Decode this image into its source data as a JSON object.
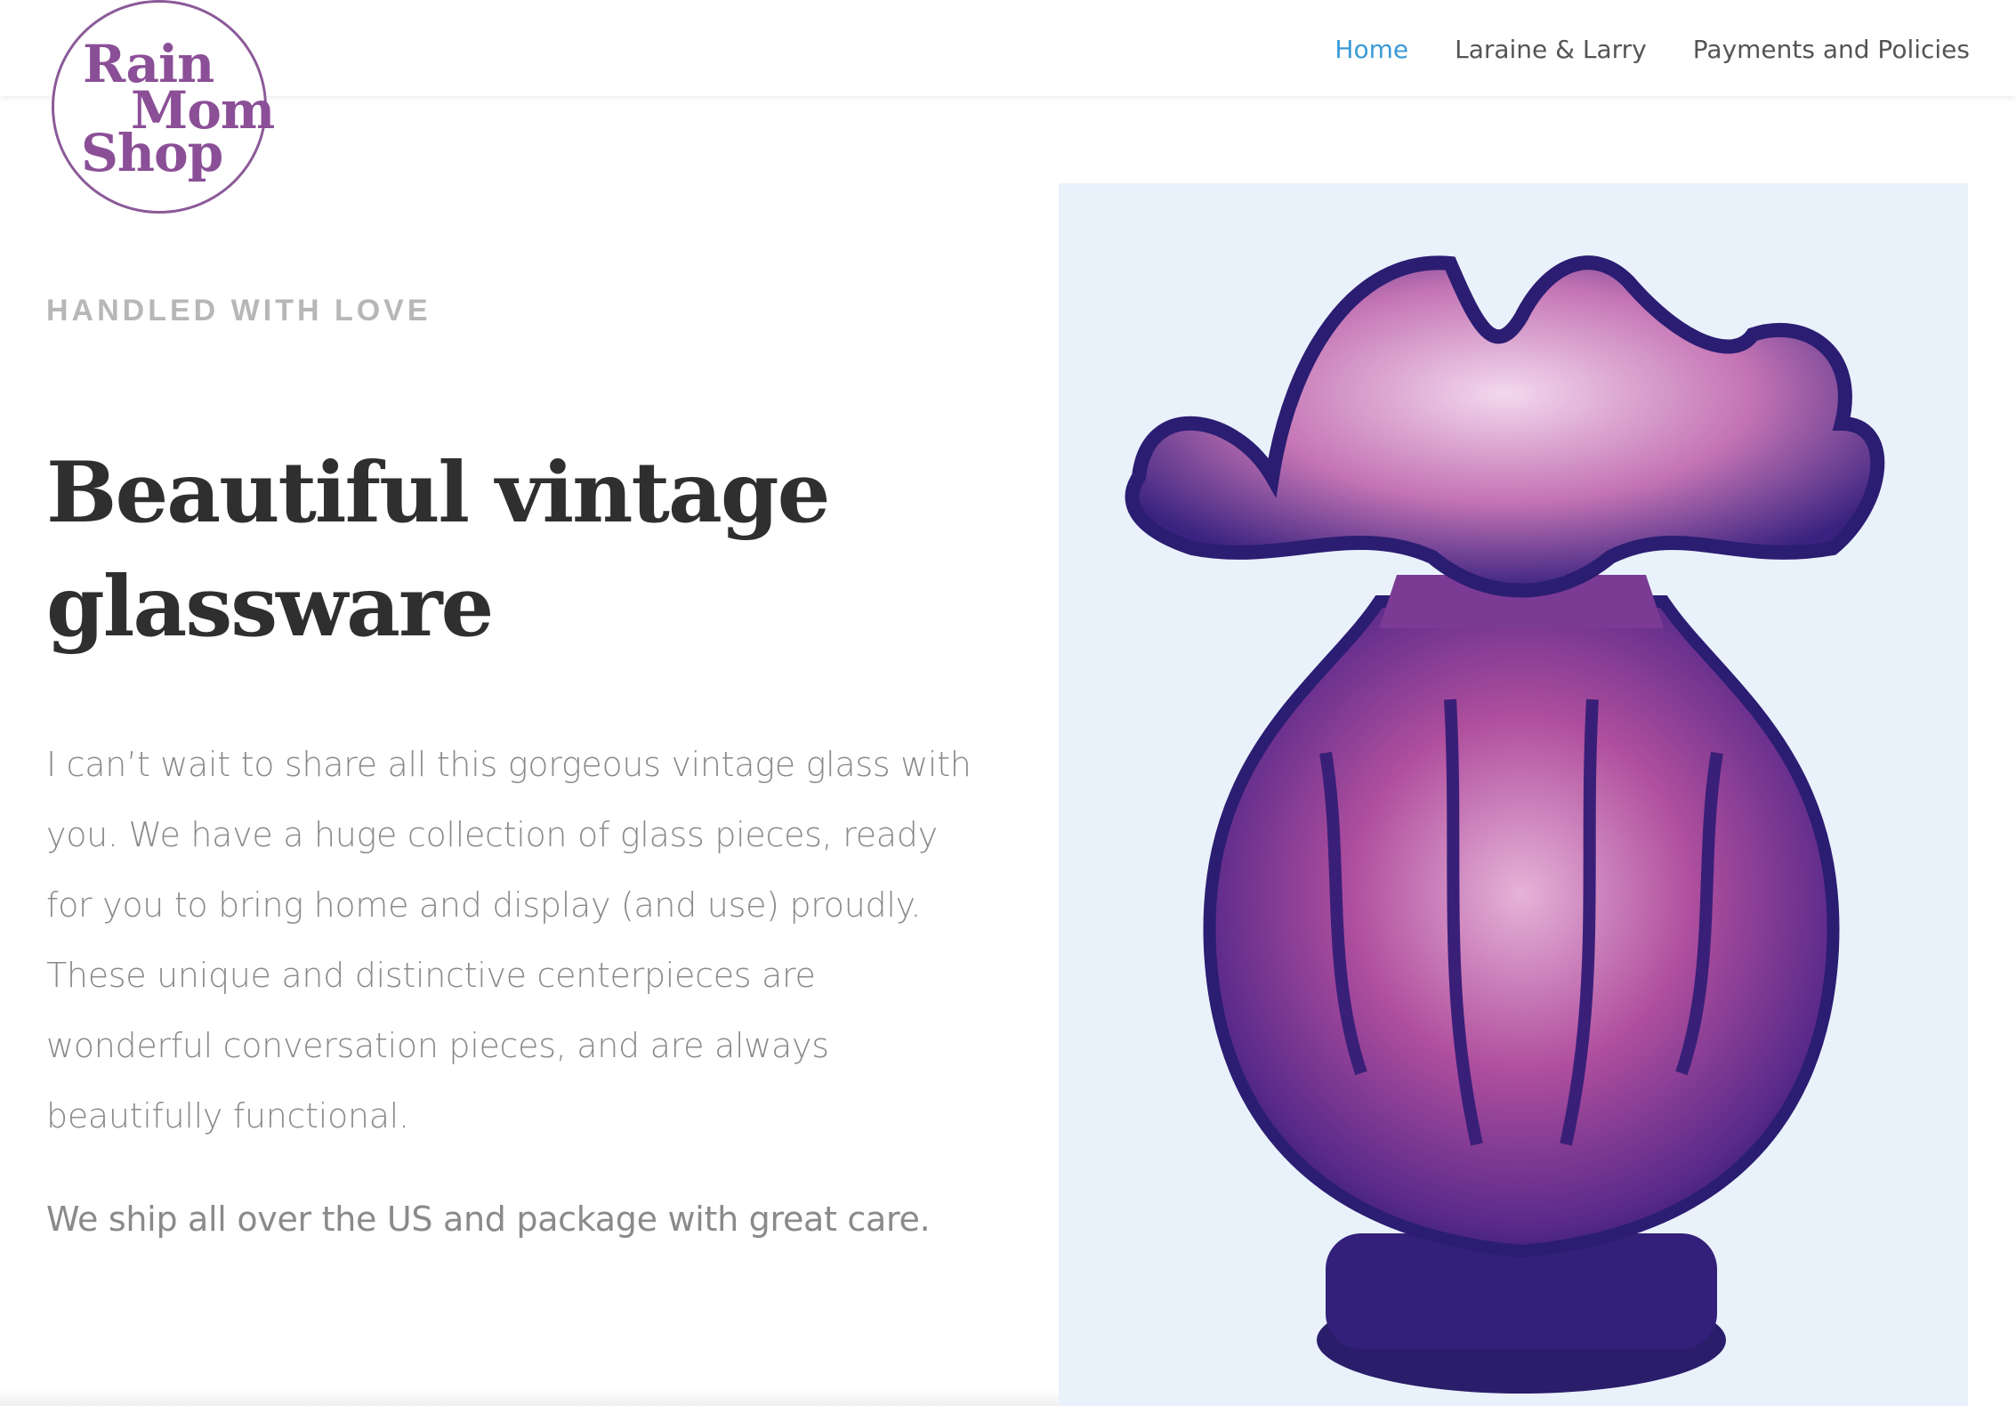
{
  "logo": {
    "line1": "Rain",
    "line2": "Mom",
    "line3": "Shop"
  },
  "nav": {
    "items": [
      {
        "label": "Home",
        "active": true
      },
      {
        "label": "Laraine & Larry",
        "active": false
      },
      {
        "label": "Payments and Policies",
        "active": false
      }
    ]
  },
  "hero": {
    "eyebrow": "HANDLED WITH LOVE",
    "headline_line1": "Beautiful vintage",
    "headline_line2": "glassware",
    "paragraph1": "I can’t wait to share all this gorgeous vintage glass with you. We have a huge collection of glass pieces, ready for you to bring home and display (and use) proudly. These unique and distinctive centerpieces are wonderful conversation pieces, and are always beautifully functional.",
    "paragraph2": "We ship all over the US and package with great care."
  },
  "image": {
    "subject": "purple ruffled glass vase"
  },
  "colors": {
    "brand_purple": "#8b4f97",
    "nav_active": "#3c9ad6",
    "nav_text": "#555555",
    "headline": "#2f2f2f",
    "body_text": "#8a8a8a",
    "eyebrow": "#b7b7b7"
  }
}
